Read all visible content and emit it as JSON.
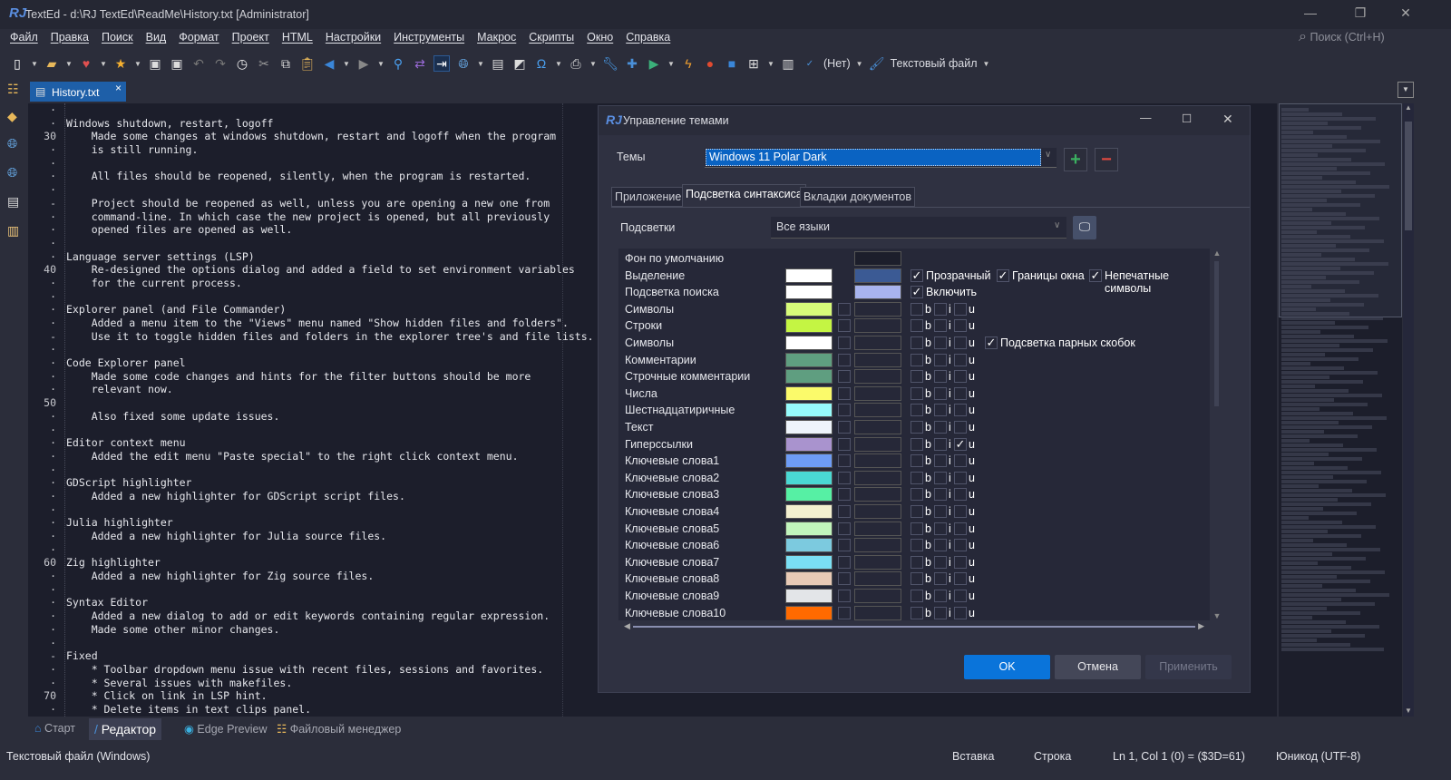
{
  "window": {
    "title": "TextEd - d:\\RJ TextEd\\ReadMe\\History.txt [Administrator]",
    "logo": "RJ"
  },
  "menu": [
    "Файл",
    "Правка",
    "Поиск",
    "Вид",
    "Формат",
    "Проект",
    "HTML",
    "Настройки",
    "Инструменты",
    "Макрос",
    "Скрипты",
    "Окно",
    "Справка"
  ],
  "search": {
    "placeholder": "Поиск (Ctrl+H)"
  },
  "toolbar": {
    "spell_value": "(Нет)",
    "filetype": "Текстовый файл"
  },
  "doc_tab": {
    "label": "History.txt",
    "close": "×"
  },
  "editor": {
    "gutter": [
      "·",
      "·",
      "30",
      "·",
      "·",
      "·",
      "·",
      "-",
      "·",
      "·",
      "·",
      "·",
      "40",
      "·",
      "·",
      "·",
      "·",
      "-",
      "·",
      "·",
      "·",
      "·",
      "50",
      "·",
      "·",
      "·",
      "·",
      "·",
      "·",
      "·",
      "·",
      "·",
      "·",
      "·",
      "60",
      "·",
      "·",
      "·",
      "·",
      "·",
      "·",
      "-",
      "·",
      "·",
      "70",
      "·",
      "·",
      "·",
      "·"
    ],
    "lines": [
      "",
      "Windows shutdown, restart, logoff",
      "    Made some changes at windows shutdown, restart and logoff when the program",
      "    is still running.",
      "",
      "    All files should be reopened, silently, when the program is restarted.",
      "",
      "    Project should be reopened as well, unless you are opening a new one from",
      "    command-line. In which case the new project is opened, but all previously",
      "    opened files are opened as well.",
      "",
      "Language server settings (LSP)",
      "    Re-designed the options dialog and added a field to set environment variables",
      "    for the current process.",
      "",
      "Explorer panel (and File Commander)",
      "    Added a menu item to the \"Views\" menu named \"Show hidden files and folders\".",
      "    Use it to toggle hidden files and folders in the explorer tree's and file lists.",
      "",
      "Code Explorer panel",
      "    Made some code changes and hints for the filter buttons should be more",
      "    relevant now.",
      "",
      "    Also fixed some update issues.",
      "",
      "Editor context menu",
      "    Added the edit menu \"Paste special\" to the right click context menu.",
      "",
      "GDScript highlighter",
      "    Added a new highlighter for GDScript script files.",
      "",
      "Julia highlighter",
      "    Added a new highlighter for Julia source files.",
      "",
      "Zig highlighter",
      "    Added a new highlighter for Zig source files.",
      "",
      "Syntax Editor",
      "    Added a new dialog to add or edit keywords containing regular expression.",
      "    Made some other minor changes.",
      "",
      "Fixed",
      "    * Toolbar dropdown menu issue with recent files, sessions and favorites.",
      "    * Several issues with makefiles.",
      "    * Click on link in LSP hint.",
      "    * Delete items in text clips panel."
    ]
  },
  "dialog": {
    "title": "Управление темами",
    "themes_label": "Темы",
    "theme_value": "Windows 11 Polar Dark",
    "tabs": [
      "Приложение",
      "Подсветка синтаксиса",
      "Вкладки документов"
    ],
    "active_tab": 1,
    "highlighters_label": "Подсветки",
    "highlighters_value": "Все языки",
    "opts": {
      "transparent": "Прозрачный",
      "borders": "Границы окна",
      "nonprint": "Непечатные символы",
      "enable": "Включить",
      "brackets": "Подсветка парных скобок"
    },
    "rows": [
      {
        "name": "Фон по умолчанию",
        "fg": null,
        "bg": "#1c1e2b"
      },
      {
        "name": "Выделение",
        "fg": "#ffffff",
        "bg": "#3b5a94"
      },
      {
        "name": "Подсветка поиска",
        "fg": "#ffffff",
        "bg": "#a8b4ee"
      },
      {
        "name": "Символы",
        "fg": "#d7fb7a",
        "bg": "#262838",
        "b": false,
        "i": false,
        "u": false
      },
      {
        "name": "Строки",
        "fg": "#c4f543",
        "bg": "#262838",
        "b": false,
        "i": false,
        "u": false
      },
      {
        "name": "Символы",
        "fg": "#ffffff",
        "bg": "#262838",
        "b": false,
        "i": false,
        "u": false
      },
      {
        "name": "Комментарии",
        "fg": "#5f9e80",
        "bg": "#262838",
        "b": false,
        "i": false,
        "u": false
      },
      {
        "name": "Строчные комментарии",
        "fg": "#5f9e80",
        "bg": "#262838",
        "b": false,
        "i": false,
        "u": false
      },
      {
        "name": "Числа",
        "fg": "#fbfa6a",
        "bg": "#262838",
        "b": false,
        "i": false,
        "u": false
      },
      {
        "name": "Шестнадцатиричные",
        "fg": "#96fbfc",
        "bg": "#262838",
        "b": false,
        "i": false,
        "u": false
      },
      {
        "name": "Текст",
        "fg": "#eef4fb",
        "bg": "#262838",
        "b": false,
        "i": false,
        "u": false
      },
      {
        "name": "Гиперссылки",
        "fg": "#a993ce",
        "bg": "#262838",
        "b": false,
        "i": false,
        "u": true
      },
      {
        "name": "Ключевые слова1",
        "fg": "#6e9cf6",
        "bg": "#262838",
        "b": false,
        "i": false,
        "u": false
      },
      {
        "name": "Ключевые слова2",
        "fg": "#4ad8d3",
        "bg": "#262838",
        "b": false,
        "i": false,
        "u": false
      },
      {
        "name": "Ключевые слова3",
        "fg": "#56f0a4",
        "bg": "#262838",
        "b": false,
        "i": false,
        "u": false
      },
      {
        "name": "Ключевые слова4",
        "fg": "#f3f0d0",
        "bg": "#262838",
        "b": false,
        "i": false,
        "u": false
      },
      {
        "name": "Ключевые слова5",
        "fg": "#c1f4bc",
        "bg": "#262838",
        "b": false,
        "i": false,
        "u": false
      },
      {
        "name": "Ключевые слова6",
        "fg": "#7ccadf",
        "bg": "#262838",
        "b": false,
        "i": false,
        "u": false
      },
      {
        "name": "Ключевые слова7",
        "fg": "#7adff4",
        "bg": "#262838",
        "b": false,
        "i": false,
        "u": false
      },
      {
        "name": "Ключевые слова8",
        "fg": "#e8cab6",
        "bg": "#262838",
        "b": false,
        "i": false,
        "u": false
      },
      {
        "name": "Ключевые слова9",
        "fg": "#e3e5e8",
        "bg": "#262838",
        "b": false,
        "i": false,
        "u": false
      },
      {
        "name": "Ключевые слова10",
        "fg": "#ff6a00",
        "bg": "#262838",
        "b": false,
        "i": false,
        "u": false
      }
    ],
    "letters": {
      "b": "b",
      "i": "i",
      "u": "u"
    },
    "ok": "OK",
    "cancel": "Отмена",
    "apply": "Применить"
  },
  "bottom_tabs": [
    "Старт",
    "Редактор",
    "Edge Preview",
    "Файловый менеджер"
  ],
  "status": {
    "filetype": "Текстовый файл (Windows)",
    "mode": "Вставка",
    "sel": "Строка",
    "pos": "Ln 1, Col 1 (0) = ($3D=61)",
    "enc": "Юникод (UTF-8)"
  },
  "colors": {
    "accent": "#0a74da",
    "tab_active": "#1e5fa8",
    "editor_bg": "#1c1e2b"
  }
}
